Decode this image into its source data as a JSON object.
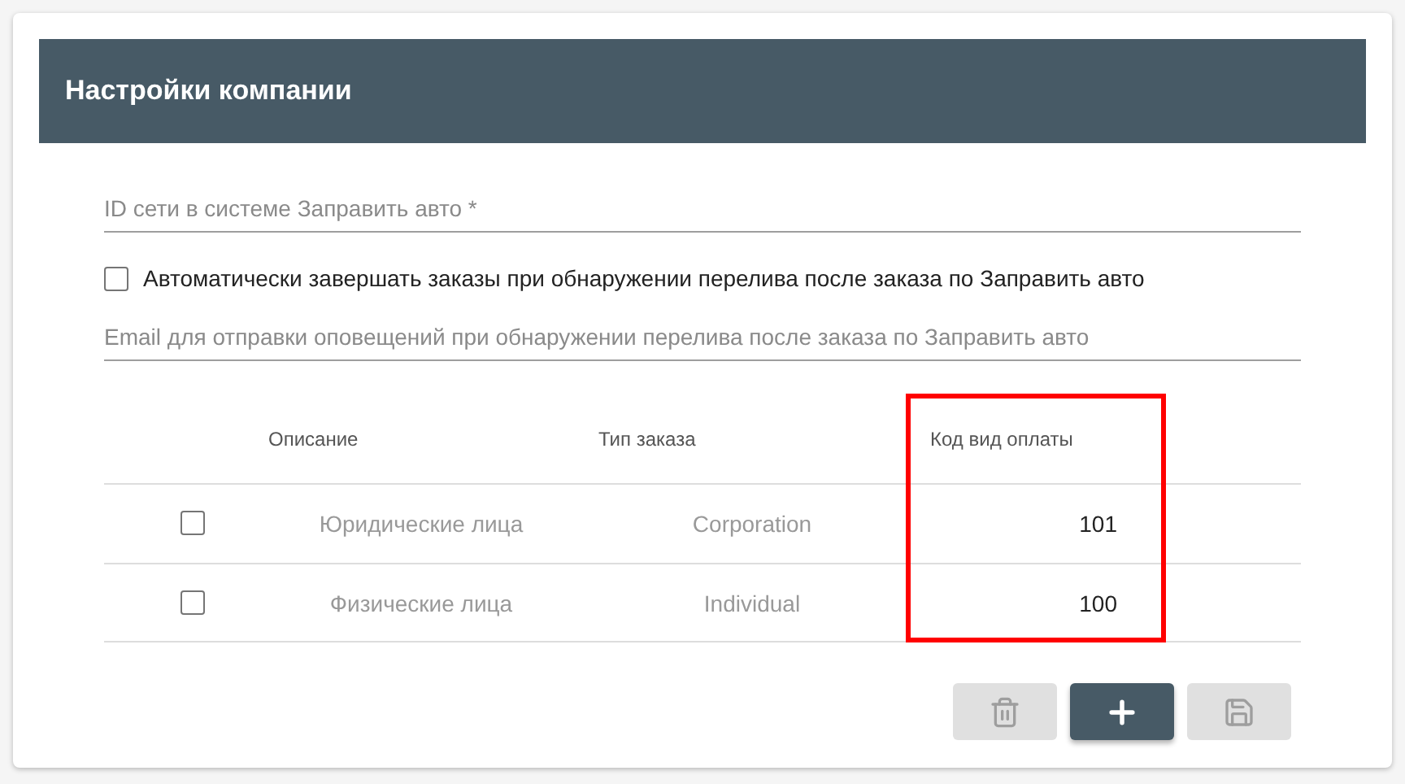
{
  "panel": {
    "title": "Настройки компании"
  },
  "fields": [
    {
      "kind": "input",
      "placeholder": "ID сети в системе Заправить авто *"
    },
    {
      "kind": "checkbox",
      "label": "Автоматически завершать заказы при обнаружении перелива после заказа по Заправить авто",
      "checked": false
    },
    {
      "kind": "input",
      "placeholder": "Email для отправки оповещений при обнаружении перелива после заказа по Заправить авто"
    }
  ],
  "table": {
    "columns": [
      {
        "label": "Описание",
        "highlighted": false
      },
      {
        "label": "Тип заказа",
        "highlighted": false
      },
      {
        "label": "Код вид оплаты",
        "highlighted": true
      }
    ],
    "rows": [
      {
        "checked": false,
        "cells": [
          "Юридические лица",
          "Corporation",
          "101"
        ]
      },
      {
        "checked": false,
        "cells": [
          "Физические лица",
          "Individual",
          "100"
        ]
      }
    ]
  },
  "buttons": [
    {
      "kind": "delete",
      "disabled": true
    },
    {
      "kind": "add",
      "disabled": false
    },
    {
      "kind": "save",
      "disabled": true
    }
  ]
}
